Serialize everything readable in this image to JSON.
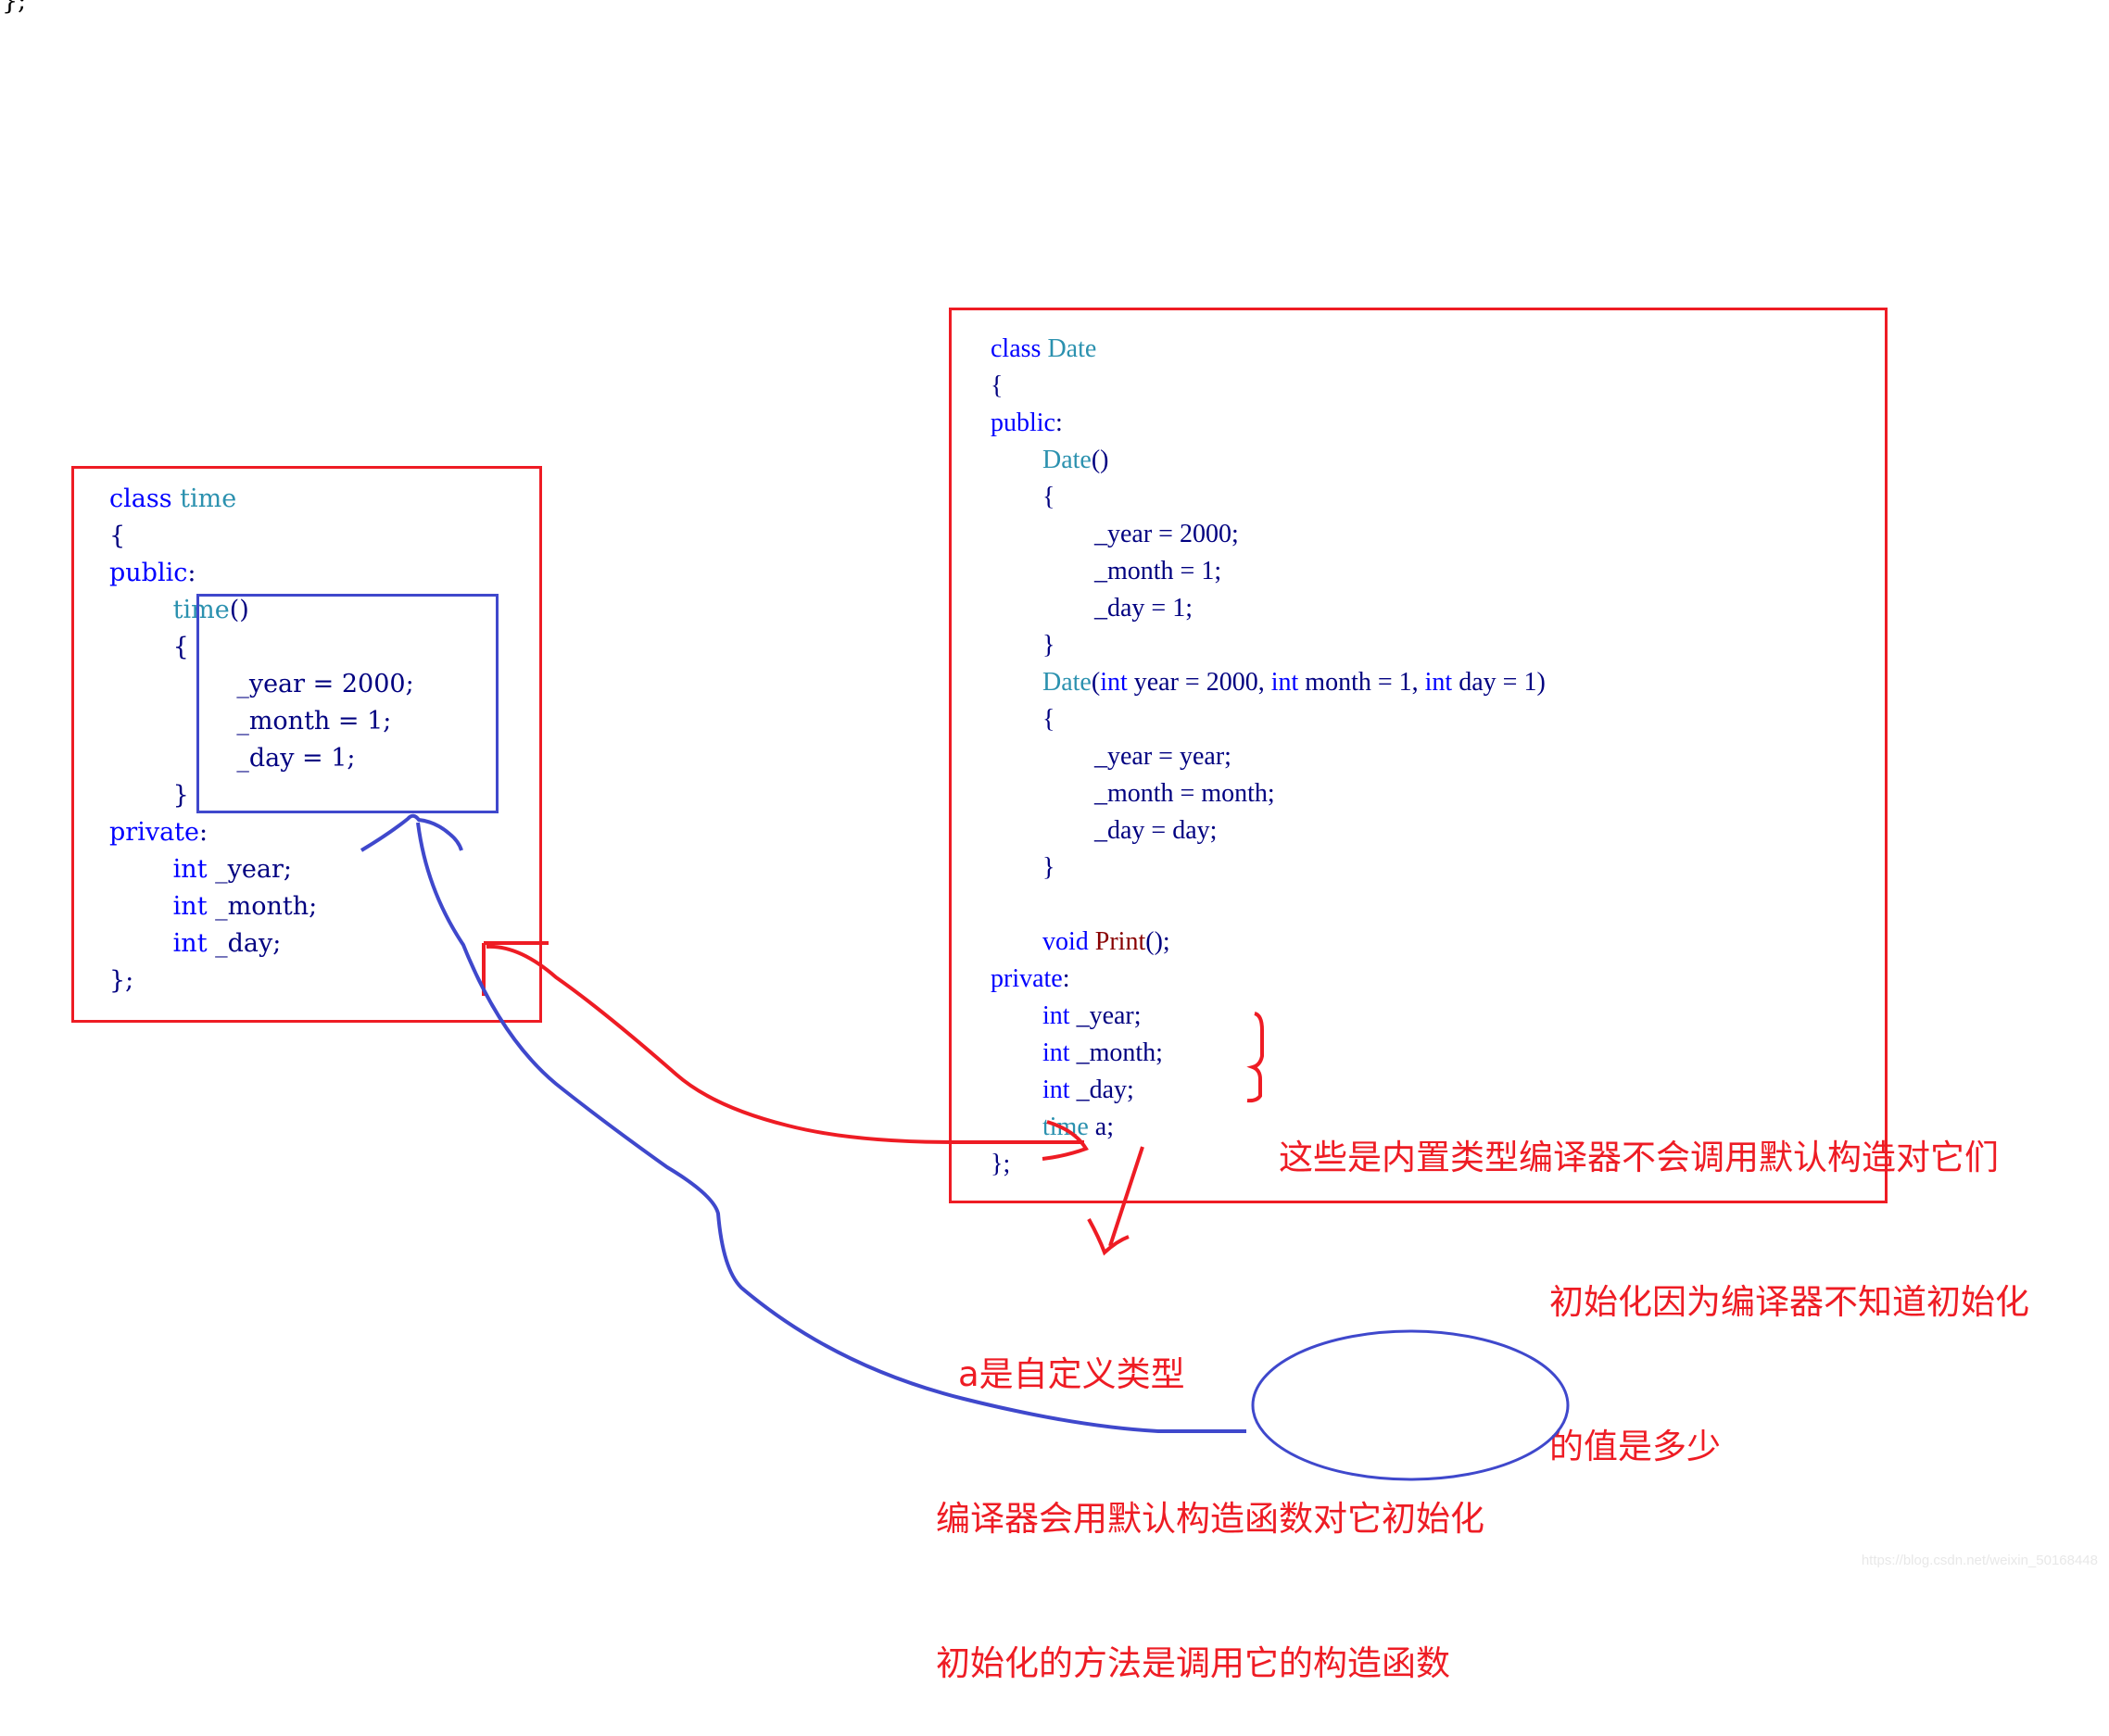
{
  "top_fragment": "};",
  "left_code": {
    "title": "class time",
    "lines": [
      {
        "indent": 0,
        "tokens": [
          {
            "t": "class ",
            "c": "kw"
          },
          {
            "t": "time",
            "c": "ty"
          }
        ]
      },
      {
        "indent": 0,
        "tokens": [
          {
            "t": "{",
            "c": "nm"
          }
        ]
      },
      {
        "indent": 0,
        "tokens": [
          {
            "t": "public",
            "c": "kw"
          },
          {
            "t": ":",
            "c": "nm"
          }
        ]
      },
      {
        "indent": 1,
        "tokens": [
          {
            "t": "time",
            "c": "ty"
          },
          {
            "t": "()",
            "c": "nm"
          }
        ]
      },
      {
        "indent": 1,
        "tokens": [
          {
            "t": "{",
            "c": "nm"
          }
        ]
      },
      {
        "indent": 2,
        "tokens": [
          {
            "t": "_year = 2000;",
            "c": "nm"
          }
        ]
      },
      {
        "indent": 2,
        "tokens": [
          {
            "t": "_month = 1;",
            "c": "nm"
          }
        ]
      },
      {
        "indent": 2,
        "tokens": [
          {
            "t": "_day = 1;",
            "c": "nm"
          }
        ]
      },
      {
        "indent": 1,
        "tokens": [
          {
            "t": "}",
            "c": "nm"
          }
        ]
      },
      {
        "indent": 0,
        "tokens": [
          {
            "t": "private",
            "c": "kw"
          },
          {
            "t": ":",
            "c": "nm"
          }
        ]
      },
      {
        "indent": 1,
        "tokens": [
          {
            "t": "int",
            "c": "kw"
          },
          {
            "t": " _year;",
            "c": "nm"
          }
        ]
      },
      {
        "indent": 1,
        "tokens": [
          {
            "t": "int",
            "c": "kw"
          },
          {
            "t": " _month;",
            "c": "nm"
          }
        ]
      },
      {
        "indent": 1,
        "tokens": [
          {
            "t": "int",
            "c": "kw"
          },
          {
            "t": " _day;",
            "c": "nm"
          }
        ]
      },
      {
        "indent": 0,
        "tokens": [
          {
            "t": "};",
            "c": "nm"
          }
        ]
      }
    ]
  },
  "right_code": {
    "title": "class Date",
    "lines": [
      {
        "indent": 0,
        "tokens": [
          {
            "t": "class ",
            "c": "kw"
          },
          {
            "t": "Date",
            "c": "ty"
          }
        ]
      },
      {
        "indent": 0,
        "tokens": [
          {
            "t": "{",
            "c": "nm"
          }
        ]
      },
      {
        "indent": 0,
        "tokens": [
          {
            "t": "public",
            "c": "kw"
          },
          {
            "t": ":",
            "c": "nm"
          }
        ]
      },
      {
        "indent": 1,
        "tokens": [
          {
            "t": "Date",
            "c": "ty"
          },
          {
            "t": "()",
            "c": "nm"
          }
        ]
      },
      {
        "indent": 1,
        "tokens": [
          {
            "t": "{",
            "c": "nm"
          }
        ]
      },
      {
        "indent": 2,
        "tokens": [
          {
            "t": "_year = 2000;",
            "c": "nm"
          }
        ]
      },
      {
        "indent": 2,
        "tokens": [
          {
            "t": "_month = 1;",
            "c": "nm"
          }
        ]
      },
      {
        "indent": 2,
        "tokens": [
          {
            "t": "_day = 1;",
            "c": "nm"
          }
        ]
      },
      {
        "indent": 1,
        "tokens": [
          {
            "t": "}",
            "c": "nm"
          }
        ]
      },
      {
        "indent": 1,
        "tokens": [
          {
            "t": "Date",
            "c": "ty"
          },
          {
            "t": "(",
            "c": "nm"
          },
          {
            "t": "int",
            "c": "kw"
          },
          {
            "t": " year = 2000, ",
            "c": "nm"
          },
          {
            "t": "int",
            "c": "kw"
          },
          {
            "t": " month = 1, ",
            "c": "nm"
          },
          {
            "t": "int",
            "c": "kw"
          },
          {
            "t": " day = 1)",
            "c": "nm"
          }
        ]
      },
      {
        "indent": 1,
        "tokens": [
          {
            "t": "{",
            "c": "nm"
          }
        ]
      },
      {
        "indent": 2,
        "tokens": [
          {
            "t": "_year = year;",
            "c": "nm"
          }
        ]
      },
      {
        "indent": 2,
        "tokens": [
          {
            "t": "_month = month;",
            "c": "nm"
          }
        ]
      },
      {
        "indent": 2,
        "tokens": [
          {
            "t": "_day = day;",
            "c": "nm"
          }
        ]
      },
      {
        "indent": 1,
        "tokens": [
          {
            "t": "}",
            "c": "nm"
          }
        ]
      },
      {
        "indent": 0,
        "tokens": [
          {
            "t": "",
            "c": "nm"
          }
        ]
      },
      {
        "indent": 1,
        "tokens": [
          {
            "t": "void ",
            "c": "kw"
          },
          {
            "t": "Print",
            "c": "fn"
          },
          {
            "t": "();",
            "c": "nm"
          }
        ]
      },
      {
        "indent": 0,
        "tokens": [
          {
            "t": "private",
            "c": "kw"
          },
          {
            "t": ":",
            "c": "nm"
          }
        ]
      },
      {
        "indent": 1,
        "tokens": [
          {
            "t": "int",
            "c": "kw"
          },
          {
            "t": " _year;",
            "c": "nm"
          }
        ]
      },
      {
        "indent": 1,
        "tokens": [
          {
            "t": "int",
            "c": "kw"
          },
          {
            "t": " _month;",
            "c": "nm"
          }
        ]
      },
      {
        "indent": 1,
        "tokens": [
          {
            "t": "int",
            "c": "kw"
          },
          {
            "t": " _day;",
            "c": "nm"
          }
        ]
      },
      {
        "indent": 1,
        "tokens": [
          {
            "t": "time",
            "c": "ty"
          },
          {
            "t": " a;",
            "c": "nm"
          }
        ]
      },
      {
        "indent": 0,
        "tokens": [
          {
            "t": "};",
            "c": "nm"
          }
        ]
      }
    ]
  },
  "annotations": {
    "builtin_note": [
      "这些是内置类型编译器不会调用默认构造对它们",
      "初始化因为编译器不知道初始化",
      "的值是多少"
    ],
    "custom_note": [
      "a是自定义类型",
      "编译器会用默认构造函数对它初始化",
      "初始化的方法是调用它的构造函数"
    ]
  },
  "colors": {
    "annotation_red": "#ee1c24",
    "annotation_blue": "#3f48cc",
    "keyword": "#0000ff",
    "type": "#2b91af",
    "function": "#880000",
    "text": "#000080"
  },
  "watermark": "https://blog.csdn.net/weixin_50168448"
}
